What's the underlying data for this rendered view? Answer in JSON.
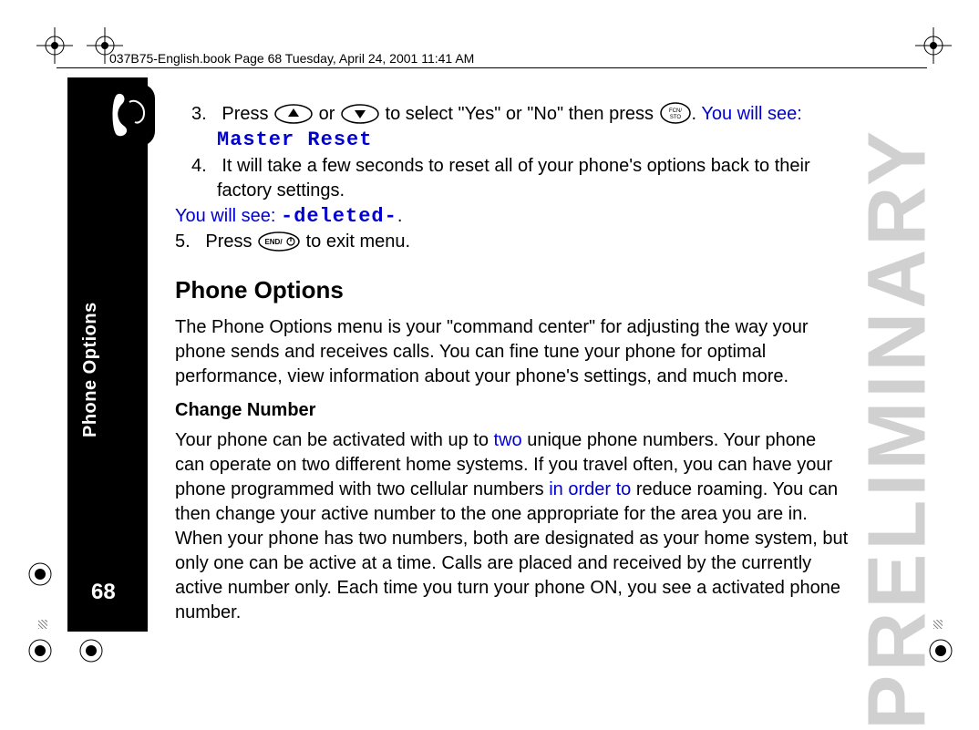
{
  "header": "037B75-English.book  Page 68  Tuesday, April 24, 2001  11:41 AM",
  "sidebar": {
    "label": "Phone Options",
    "page_number": "68"
  },
  "watermark": "PRELIMINARY",
  "step3": {
    "num": "3.",
    "a": "Press ",
    "b": " or ",
    "c": " to select \"Yes\" or \"No\" then press ",
    "d": ". ",
    "see": "You will see:",
    "lcd": "Master Reset"
  },
  "step4": {
    "num": "4.",
    "text": "It will take a few seconds to reset all of your phone's options back to their factory settings."
  },
  "see2": {
    "label": "You will see: ",
    "lcd": "-deleted-",
    "dot": "."
  },
  "step5": {
    "num": "5.",
    "a": "Press ",
    "b": " to exit menu."
  },
  "h2": "Phone Options",
  "p1": "The Phone Options menu is your \"command center\" for adjusting the way your phone sends and receives calls. You can fine tune your phone for optimal performance, view information about your phone's settings, and much more.",
  "h3": "Change Number",
  "p2a": "Your phone can be activated with up to ",
  "p2_two": "two",
  "p2b": " unique phone numbers. Your phone can operate on two different home systems. If you travel often, you can have your phone programmed with two cellular numbers ",
  "p2_inorder": "in order to",
  "p2c": " reduce roaming. You can then change your active number to the one appropriate for the area you are in. When your phone has two numbers, both are designated as your home system, but only one can be active at a time. Calls are placed and received by the currently active number only. Each time you turn your phone ON, you see a activated phone number.",
  "icons": {
    "up": "up-arrow-key",
    "down": "down-arrow-key",
    "fcn": "fcn-sto-key",
    "end": "end-power-key"
  }
}
